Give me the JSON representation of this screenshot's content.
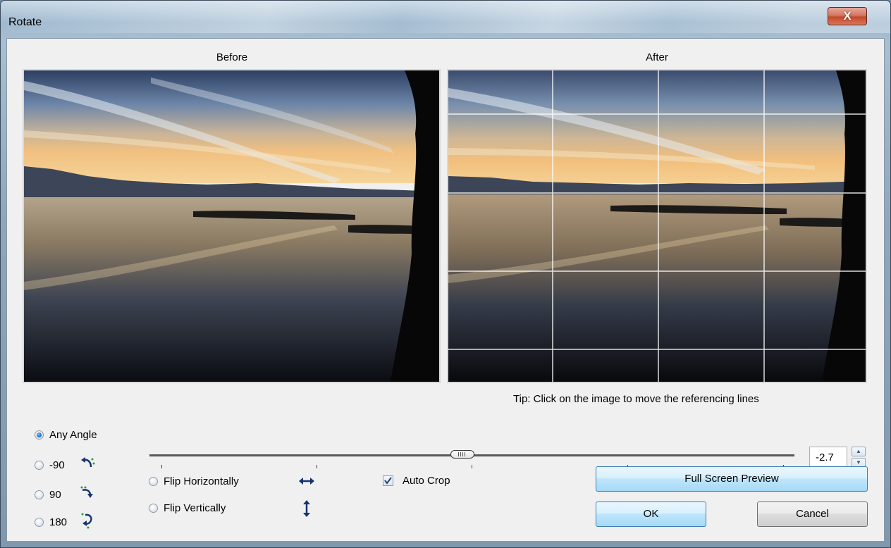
{
  "window": {
    "title": "Rotate",
    "close_label": "X"
  },
  "panels": {
    "before_label": "Before",
    "after_label": "After"
  },
  "tip": "Tip: Click on the image to move the referencing lines",
  "rotation_options": {
    "any_angle": "Any Angle",
    "minus_90": "-90",
    "plus_90": "90",
    "r180": "180",
    "selected": "Any Angle"
  },
  "angle": {
    "value": "-2.7",
    "slider_fraction": 0.485
  },
  "flip": {
    "horizontal": "Flip Horizontally",
    "vertical": "Flip Vertically"
  },
  "auto_crop": {
    "label": "Auto Crop",
    "checked": true
  },
  "buttons": {
    "full_screen": "Full Screen Preview",
    "ok": "OK",
    "cancel": "Cancel"
  },
  "icons": {
    "rotate_ccw": "rotate-ccw-icon",
    "rotate_cw": "rotate-cw-icon",
    "rotate_180": "rotate-180-icon",
    "flip_h": "flip-horizontal-icon",
    "flip_v": "flip-vertical-icon"
  }
}
